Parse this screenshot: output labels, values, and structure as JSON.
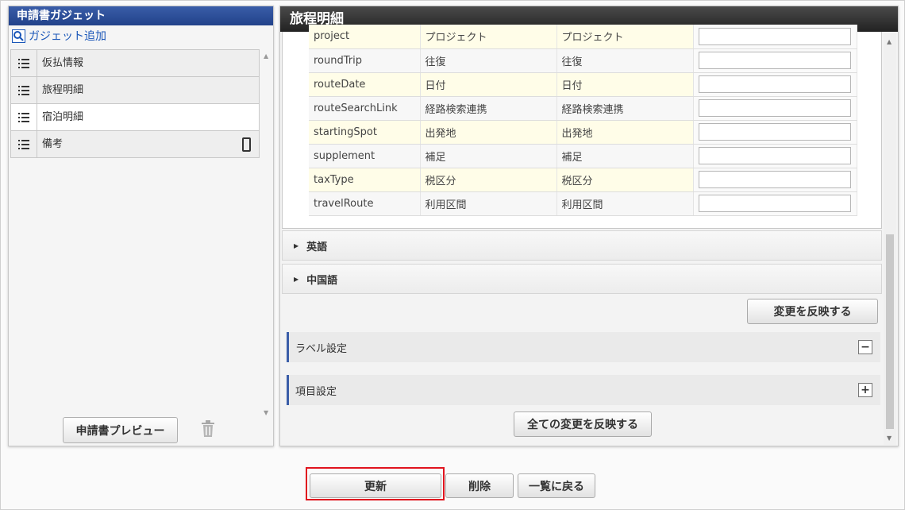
{
  "left_panel": {
    "title": "申請書ガジェット",
    "add_link": "ガジェット追加",
    "items": [
      {
        "label": "仮払情報"
      },
      {
        "label": "旅程明細"
      },
      {
        "label": "宿泊明細"
      },
      {
        "label": "備考"
      }
    ],
    "preview_button": "申請書プレビュー"
  },
  "right_panel": {
    "title": "旅程明細",
    "rows": [
      {
        "key": "project",
        "col2": "プロジェクト",
        "col3": "プロジェクト",
        "value": ""
      },
      {
        "key": "roundTrip",
        "col2": "往復",
        "col3": "往復",
        "value": ""
      },
      {
        "key": "routeDate",
        "col2": "日付",
        "col3": "日付",
        "value": ""
      },
      {
        "key": "routeSearchLink",
        "col2": "経路検索連携",
        "col3": "経路検索連携",
        "value": ""
      },
      {
        "key": "startingSpot",
        "col2": "出発地",
        "col3": "出発地",
        "value": ""
      },
      {
        "key": "supplement",
        "col2": "補足",
        "col3": "補足",
        "value": ""
      },
      {
        "key": "taxType",
        "col2": "税区分",
        "col3": "税区分",
        "value": ""
      },
      {
        "key": "travelRoute",
        "col2": "利用区間",
        "col3": "利用区間",
        "value": ""
      }
    ],
    "accordions": {
      "english": "英語",
      "chinese": "中国語"
    },
    "reflect_button": "変更を反映する",
    "sections": {
      "label_settings": {
        "label": "ラベル設定",
        "toggle": "−"
      },
      "item_settings": {
        "label": "項目設定",
        "toggle": "+"
      }
    },
    "reflect_all_button": "全ての変更を反映する"
  },
  "bottom": {
    "update_button": "更新",
    "delete_button": "削除",
    "back_button": "一覧に戻る"
  },
  "colors": {
    "header_blue": "#2b4a96",
    "highlight_red": "#e0141e"
  }
}
